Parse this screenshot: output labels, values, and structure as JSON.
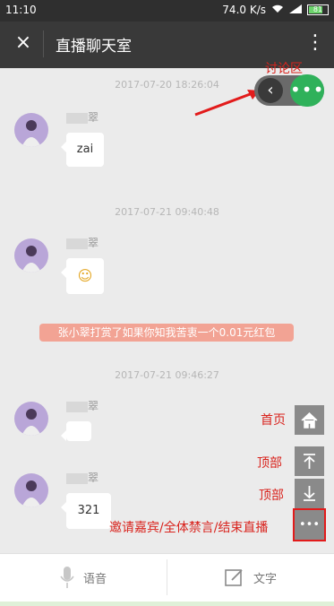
{
  "status": {
    "time": "11:10",
    "speed": "74.0 K/s",
    "battery": "81"
  },
  "header": {
    "title": "直播聊天室",
    "close_icon": "×",
    "more_icon": "⋮"
  },
  "messages": [
    {
      "timestamp": "2017-07-20 18:26:04",
      "name_suffix": "翠",
      "text": "zai"
    },
    {
      "timestamp": "2017-07-21 09:40:48",
      "name_suffix": "翠",
      "text": "☺"
    },
    {
      "timestamp": "2017-07-21 09:46:27",
      "name_suffix": "翠",
      "text": ""
    },
    {
      "timestamp": "",
      "name_suffix": "翠",
      "text": "321"
    }
  ],
  "gift_notice": "张小翠打赏了如果你知我苦衷一个0.01元红包",
  "annotations": {
    "discussion": "讨论区",
    "home": "首页",
    "top1": "顶部",
    "top2": "顶部",
    "invite": "邀请嘉宾/全体禁言/结束直播"
  },
  "toggle": {
    "back_icon": "‹",
    "dots_icon": "•••"
  },
  "side_buttons": {
    "home_icon": "⌂",
    "top_icon": "⤒",
    "down_icon": "⤓",
    "more_icon": "•••"
  },
  "inputbar": {
    "voice_label": "语音",
    "text_label": "文字"
  },
  "colors": {
    "accent_green": "#2fb15a",
    "annotation_red": "#d9231d",
    "gift_bg": "#f2a394"
  }
}
